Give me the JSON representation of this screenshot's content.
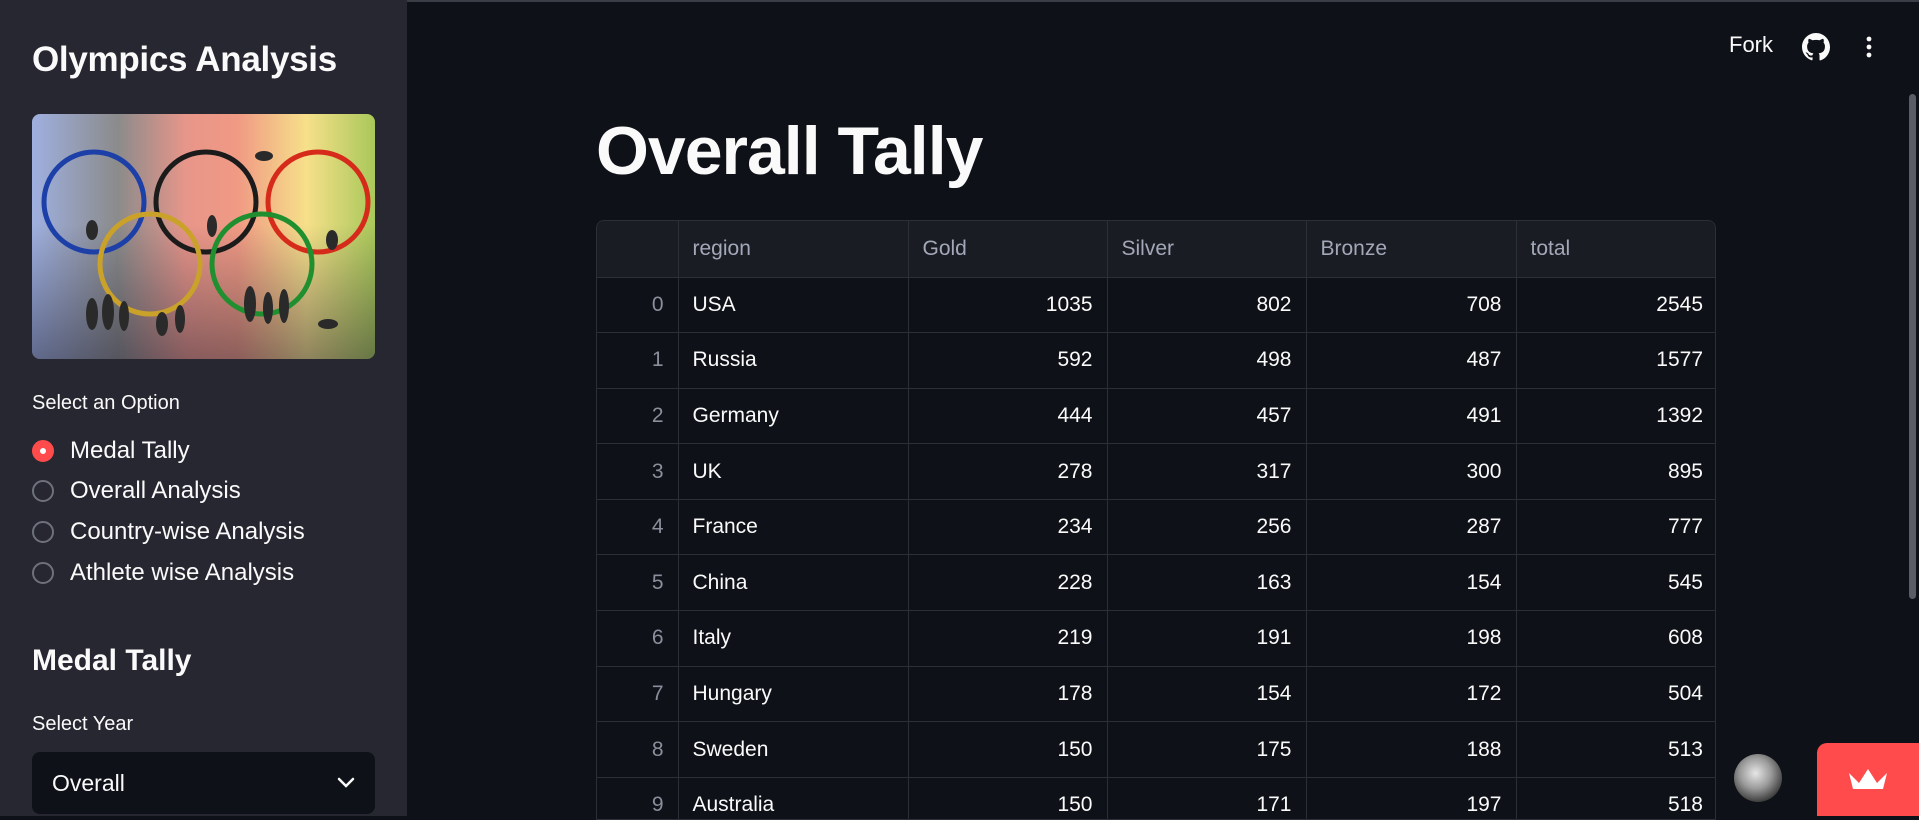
{
  "sidebar": {
    "title": "Olympics Analysis",
    "option_label": "Select an Option",
    "options": [
      {
        "label": "Medal Tally",
        "selected": true
      },
      {
        "label": "Overall Analysis",
        "selected": false
      },
      {
        "label": "Country-wise Analysis",
        "selected": false
      },
      {
        "label": "Athlete wise Analysis",
        "selected": false
      }
    ],
    "section_title": "Medal Tally",
    "year_label": "Select Year",
    "year_value": "Overall"
  },
  "toolbar": {
    "fork_label": "Fork",
    "github_icon": "github-icon",
    "menu_icon": "kebab-menu-icon"
  },
  "main": {
    "title": "Overall Tally",
    "table": {
      "columns": [
        "",
        "region",
        "Gold",
        "Silver",
        "Bronze",
        "total"
      ],
      "rows": [
        [
          "0",
          "USA",
          "1035",
          "802",
          "708",
          "2545"
        ],
        [
          "1",
          "Russia",
          "592",
          "498",
          "487",
          "1577"
        ],
        [
          "2",
          "Germany",
          "444",
          "457",
          "491",
          "1392"
        ],
        [
          "3",
          "UK",
          "278",
          "317",
          "300",
          "895"
        ],
        [
          "4",
          "France",
          "234",
          "256",
          "287",
          "777"
        ],
        [
          "5",
          "China",
          "228",
          "163",
          "154",
          "545"
        ],
        [
          "6",
          "Italy",
          "219",
          "191",
          "198",
          "608"
        ],
        [
          "7",
          "Hungary",
          "178",
          "154",
          "172",
          "504"
        ],
        [
          "8",
          "Sweden",
          "150",
          "175",
          "188",
          "513"
        ],
        [
          "9",
          "Australia",
          "150",
          "171",
          "197",
          "518"
        ]
      ]
    }
  },
  "colors": {
    "accent": "#ff4b4b",
    "background": "#0e1117",
    "sidebar": "#262730"
  }
}
